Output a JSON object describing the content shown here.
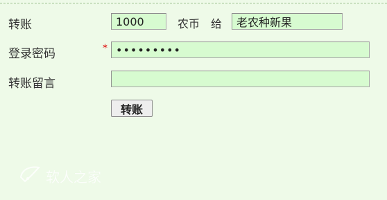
{
  "form": {
    "transfer_label": "转账",
    "transfer_amount": "1000",
    "currency_text": "农币",
    "to_text": "给",
    "recipient": "老农种新果",
    "password_label": "登录密码",
    "required_mark": "*",
    "password_value": "•••••••••",
    "message_label": "转账留言",
    "message_value": "",
    "submit_label": "转账"
  },
  "watermark": {
    "text": "软人之家",
    "icon": "leaf-logo-icon"
  },
  "colors": {
    "background": "#eefae8",
    "field_bg": "#d7fbd0",
    "required": "#dd0000"
  }
}
